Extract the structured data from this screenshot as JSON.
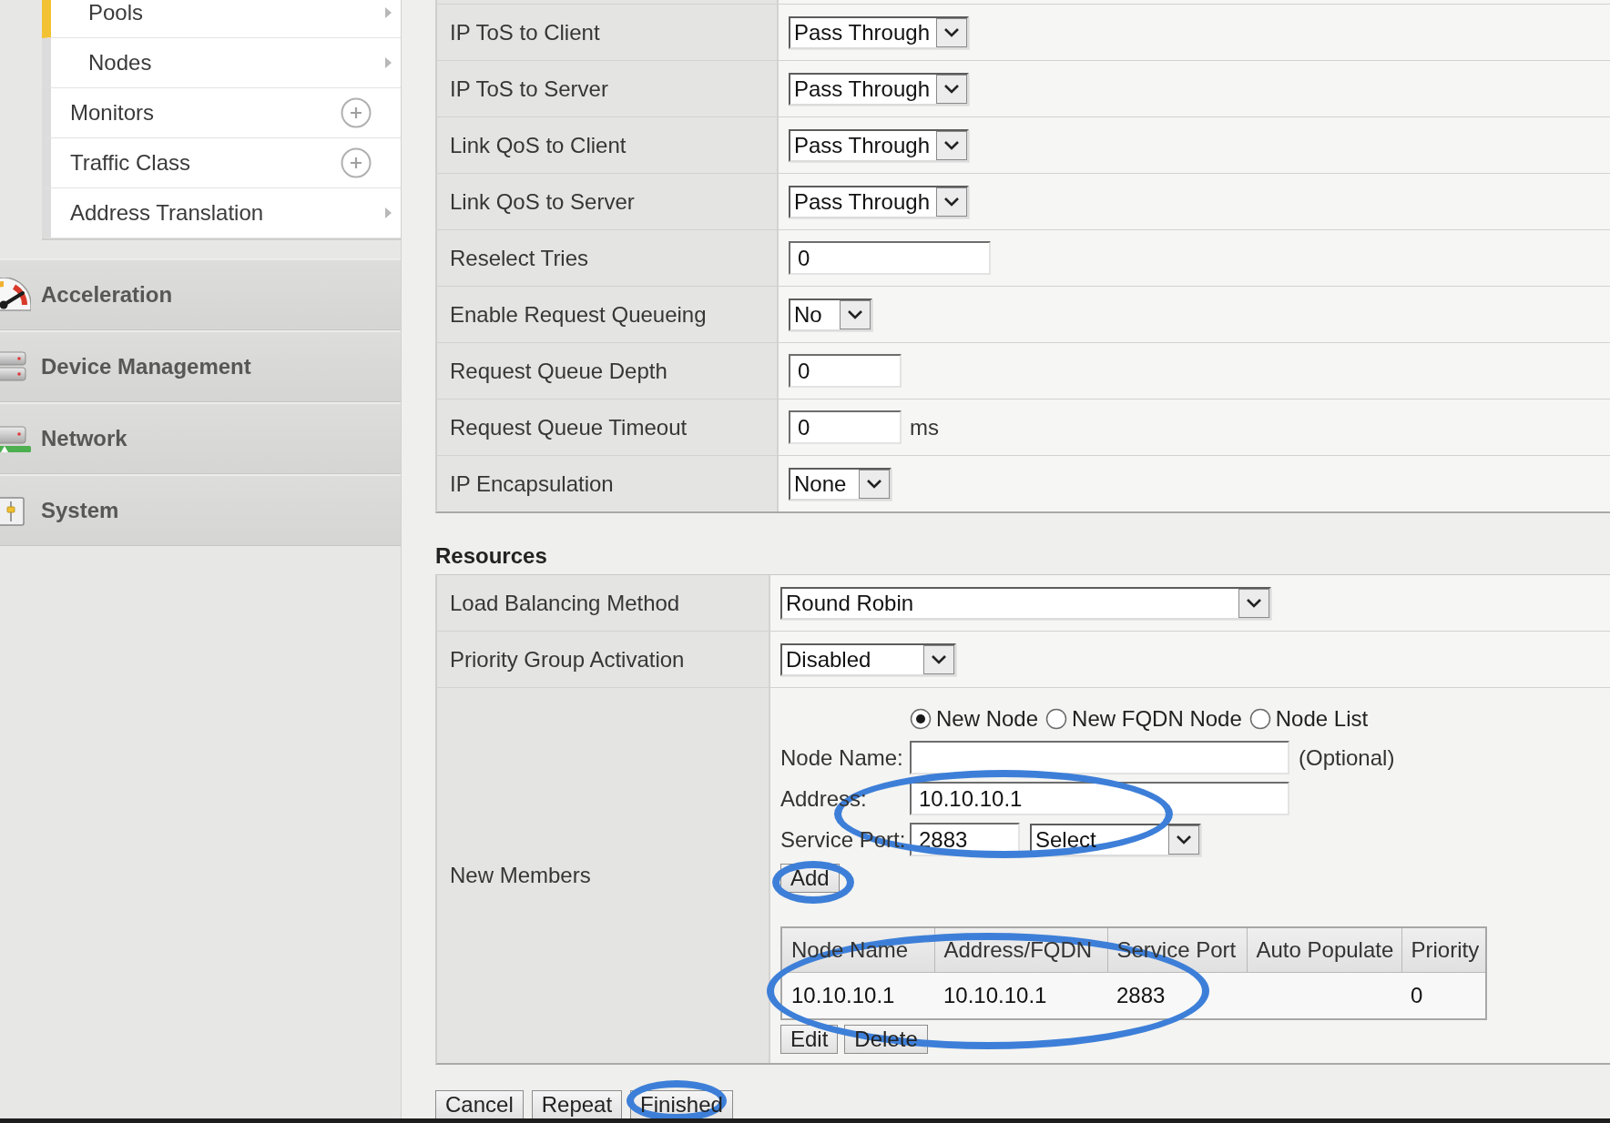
{
  "sidebar": {
    "submenu": [
      {
        "children": [
          {
            "label": "Pools",
            "selected": true,
            "kind": "arrow"
          },
          {
            "label": "Nodes",
            "selected": false,
            "kind": "arrow"
          }
        ]
      },
      {
        "label": "Monitors",
        "selected": false,
        "kind": "add"
      },
      {
        "label": "Traffic Class",
        "selected": false,
        "kind": "add"
      },
      {
        "label": "Address Translation",
        "selected": false,
        "kind": "arrow"
      }
    ],
    "sections": [
      {
        "label": "Acceleration",
        "selected": false
      },
      {
        "label": "Device Management",
        "selected": false
      },
      {
        "label": "Network",
        "selected": false
      },
      {
        "label": "System",
        "selected": false
      }
    ]
  },
  "settings": {
    "rows": [
      {
        "label": "IP ToS to Client",
        "kind": "select",
        "value": "Pass Through"
      },
      {
        "label": "IP ToS to Server",
        "kind": "select",
        "value": "Pass Through"
      },
      {
        "label": "Link QoS to Client",
        "kind": "select",
        "value": "Pass Through"
      },
      {
        "label": "Link QoS to Server",
        "kind": "select",
        "value": "Pass Through"
      },
      {
        "label": "Reselect Tries",
        "kind": "input",
        "value": "0"
      },
      {
        "label": "Enable Request Queueing",
        "kind": "select",
        "value": "No"
      },
      {
        "label": "Request Queue Depth",
        "kind": "input",
        "value": "0"
      },
      {
        "label": "Request Queue Timeout",
        "kind": "input",
        "value": "0",
        "unit": "ms"
      },
      {
        "label": "IP Encapsulation",
        "kind": "select",
        "value": "None"
      }
    ]
  },
  "resources": {
    "title": "Resources",
    "rows": [
      {
        "label": "Load Balancing Method",
        "kind": "select",
        "value": "Round Robin"
      },
      {
        "label": "Priority Group Activation",
        "kind": "select",
        "value": "Disabled"
      },
      {
        "label": "New Members",
        "kind": "members",
        "node_types": [
          {
            "label": "New Node",
            "selected": true
          },
          {
            "label": "New FQDN Node",
            "selected": false
          },
          {
            "label": "Node List",
            "selected": false
          }
        ],
        "node_name": {
          "label": "Node Name:",
          "note": "(Optional)"
        },
        "address": {
          "label": "Address:",
          "value": "10.10.10.1"
        },
        "service_port": {
          "label": "Service Port:",
          "value": "2883",
          "select": "Select"
        },
        "add_button": "Add",
        "members_table": {
          "columns": [
            "Node Name",
            "Address/FQDN",
            "Service Port",
            "Auto Populate",
            "Priority"
          ],
          "rows": [
            {
              "node_name": "10.10.10.1",
              "address_fqdn": "10.10.10.1",
              "service_port": "2883",
              "priority": "0"
            }
          ]
        },
        "row_buttons": [
          "Edit",
          "Delete"
        ]
      }
    ]
  },
  "buttons": [
    "Cancel",
    "Repeat",
    "Finished"
  ]
}
